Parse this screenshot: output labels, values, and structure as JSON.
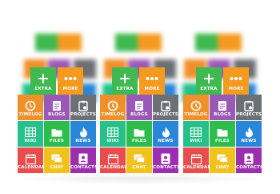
{
  "colors": {
    "extra": "#3fb950",
    "more": "#f39a1f",
    "timelog": "#f0902a",
    "blogs": "#9b59b6",
    "projects": "#6c6f73",
    "wiki": "#27c08b",
    "files": "#2dbd4a",
    "news": "#2a86d8",
    "calendar": "#e84c4c",
    "chat": "#f2c21c",
    "contacts": "#9b2fae"
  },
  "groups": [
    {
      "extra": {
        "label": "EXTRA",
        "icon": "plus-icon"
      },
      "more": {
        "label": "MORE",
        "icon": "dots-icon"
      },
      "timelog": {
        "label": "TIMELOG",
        "icon": "clock-icon"
      },
      "blogs": {
        "label": "BLOGS",
        "icon": "document-icon"
      },
      "projects": {
        "label": "PROJECTS",
        "icon": "clipboard-icon"
      },
      "wiki": {
        "label": "WIKI",
        "icon": "grid-icon"
      },
      "files": {
        "label": "FILES",
        "icon": "folder-icon"
      },
      "news": {
        "label": "NEWS",
        "icon": "flame-icon"
      },
      "calendar": {
        "label": "CALENDAR",
        "icon": "calendar-icon"
      },
      "chat": {
        "label": "CHAT",
        "icon": "chat-icon"
      },
      "contacts": {
        "label": "CONTACTS",
        "icon": "contact-icon"
      }
    },
    {
      "extra": {
        "label": "EXTRA",
        "icon": "plus-icon"
      },
      "more": {
        "label": "MORE",
        "icon": "dots-icon"
      },
      "timelog": {
        "label": "TIMELOG",
        "icon": "clock-icon"
      },
      "blogs": {
        "label": "BLOGS",
        "icon": "document-icon"
      },
      "projects": {
        "label": "PROJECTS",
        "icon": "clipboard-icon"
      },
      "wiki": {
        "label": "WIKI",
        "icon": "grid-icon"
      },
      "files": {
        "label": "FILES",
        "icon": "folder-icon"
      },
      "news": {
        "label": "NEWS",
        "icon": "flame-icon"
      },
      "calendar": {
        "label": "CALENDAR",
        "icon": "calendar-icon"
      },
      "chat": {
        "label": "CHAT",
        "icon": "chat-icon"
      },
      "contacts": {
        "label": "CONTACTS",
        "icon": "contact-icon"
      }
    },
    {
      "extra": {
        "label": "EXTRA",
        "icon": "plus-icon"
      },
      "more": {
        "label": "MORE",
        "icon": "dots-icon"
      },
      "timelog": {
        "label": "TIMELOG",
        "icon": "clock-icon"
      },
      "blogs": {
        "label": "BLOGS",
        "icon": "document-icon"
      },
      "projects": {
        "label": "PROJECTS",
        "icon": "clipboard-icon"
      },
      "wiki": {
        "label": "WIKI",
        "icon": "grid-icon"
      },
      "files": {
        "label": "FILES",
        "icon": "folder-icon"
      },
      "news": {
        "label": "NEWS",
        "icon": "flame-icon"
      },
      "calendar": {
        "label": "CALENDAR",
        "icon": "calendar-icon"
      },
      "chat": {
        "label": "CHAT",
        "icon": "chat-icon"
      },
      "contacts": {
        "label": "CONTACTS",
        "icon": "contact-icon"
      }
    }
  ]
}
